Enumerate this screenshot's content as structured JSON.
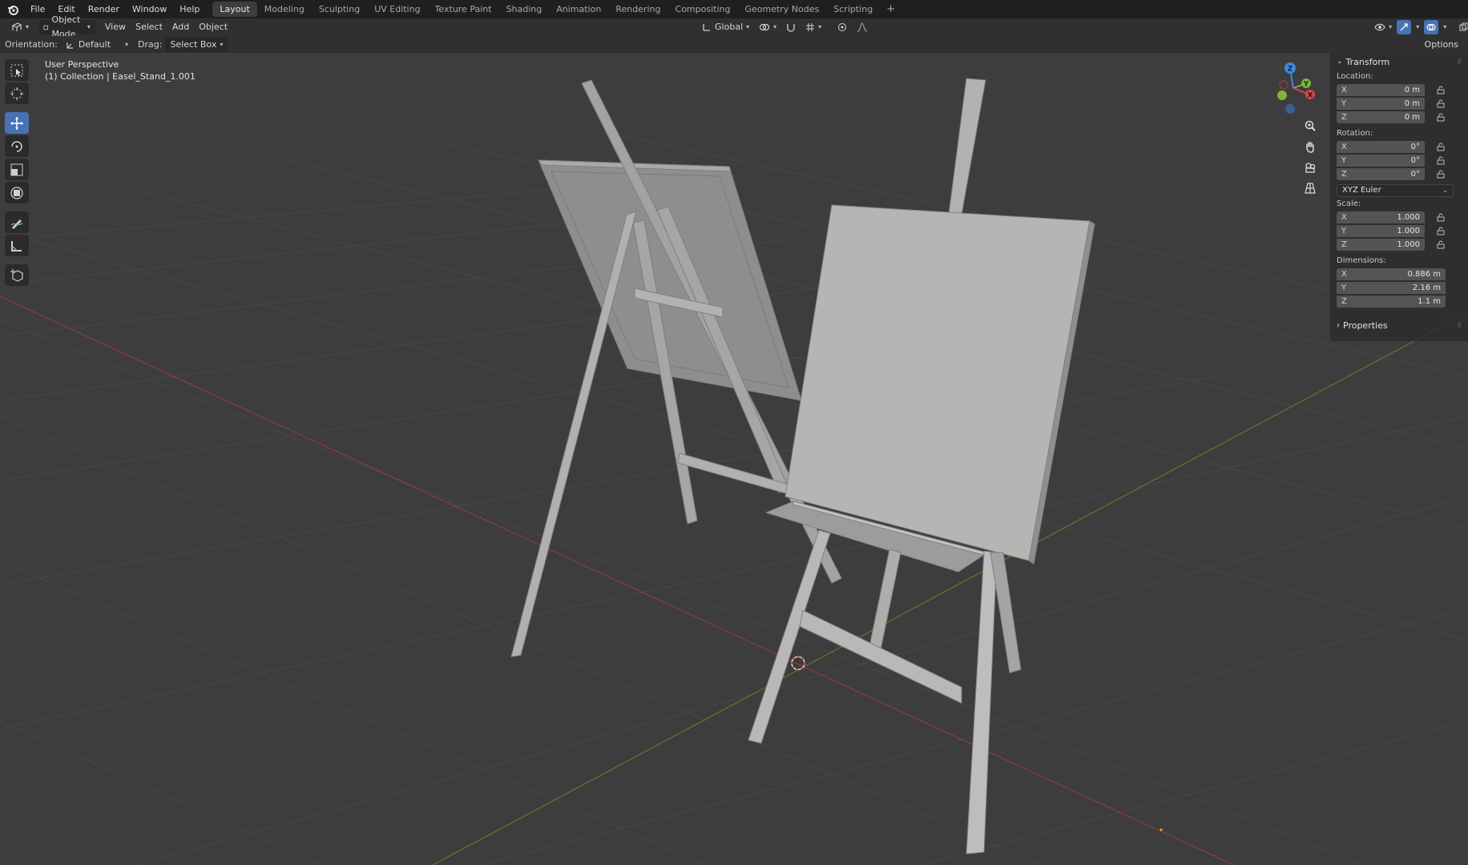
{
  "menubar": {
    "items": [
      "File",
      "Edit",
      "Render",
      "Window",
      "Help"
    ],
    "workspaces": [
      "Layout",
      "Modeling",
      "Sculpting",
      "UV Editing",
      "Texture Paint",
      "Shading",
      "Animation",
      "Rendering",
      "Compositing",
      "Geometry Nodes",
      "Scripting"
    ],
    "active_workspace": "Layout",
    "add_label": "+"
  },
  "header": {
    "mode": "Object Mode",
    "menus": [
      "View",
      "Select",
      "Add",
      "Object"
    ],
    "transform_orientation": "Global",
    "options_label": "Options"
  },
  "tool_settings": {
    "orientation_label": "Orientation:",
    "orientation_value": "Default",
    "drag_label": "Drag:",
    "drag_value": "Select Box"
  },
  "viewport": {
    "view_name": "User Perspective",
    "collection_info": "(1) Collection | Easel_Stand_1.001",
    "gizmo": {
      "x": "X",
      "y": "Y",
      "z": "Z"
    }
  },
  "transform_panel": {
    "title": "Transform",
    "location_label": "Location:",
    "location": [
      {
        "axis": "X",
        "value": "0 m"
      },
      {
        "axis": "Y",
        "value": "0 m"
      },
      {
        "axis": "Z",
        "value": "0 m"
      }
    ],
    "rotation_label": "Rotation:",
    "rotation": [
      {
        "axis": "X",
        "value": "0°"
      },
      {
        "axis": "Y",
        "value": "0°"
      },
      {
        "axis": "Z",
        "value": "0°"
      }
    ],
    "rotation_mode": "XYZ Euler",
    "scale_label": "Scale:",
    "scale": [
      {
        "axis": "X",
        "value": "1.000"
      },
      {
        "axis": "Y",
        "value": "1.000"
      },
      {
        "axis": "Z",
        "value": "1.000"
      }
    ],
    "dimensions_label": "Dimensions:",
    "dimensions": [
      {
        "axis": "X",
        "value": "0.886 m"
      },
      {
        "axis": "Y",
        "value": "2.16 m"
      },
      {
        "axis": "Z",
        "value": "1.1 m"
      }
    ],
    "properties_label": "Properties"
  },
  "colors": {
    "active_tool": "#4772b3",
    "axis_x": "#e0404f",
    "axis_y": "#7fb33a",
    "axis_z": "#3c8ae0"
  }
}
